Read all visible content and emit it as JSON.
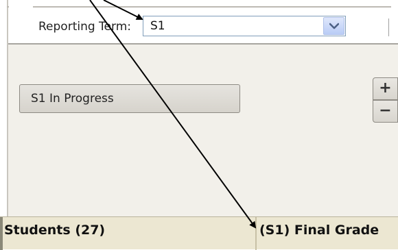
{
  "toolbar": {
    "reporting_term_label": "Reporting Term:",
    "reporting_term_value": "S1"
  },
  "content": {
    "section_button_label": "S1 In Progress",
    "zoom_in_label": "+",
    "zoom_out_label": "−"
  },
  "grid_header": {
    "students_label": "Students (27)",
    "grade_label": "(S1) Final Grade"
  },
  "colors": {
    "header_bg": "#ece7d2",
    "content_bg": "#f2f0ea",
    "select_border": "#7f9db9",
    "annotation_arrow": "#000000"
  },
  "icons": {
    "dropdown": "chevron-down-icon",
    "zoom_in": "plus-icon",
    "zoom_out": "minus-icon"
  }
}
